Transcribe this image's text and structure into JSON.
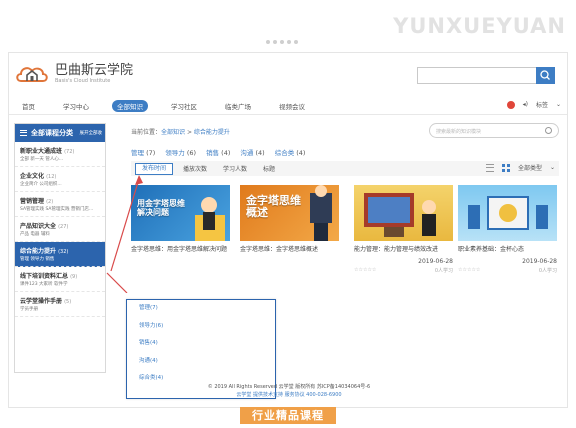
{
  "watermark": "YUNXUEYUAN",
  "logo": {
    "cn": "巴曲斯云学院",
    "en": "Basis's Cloud Institute"
  },
  "nav": {
    "items": [
      "首页",
      "学习中心",
      "全部知识",
      "学习社区",
      "临类广场",
      "视频会议"
    ],
    "right_label": "标签"
  },
  "sidebar": {
    "title": "全部课程分类",
    "toggle": "展开全部收",
    "categories": [
      {
        "title": "新职业大通成班",
        "count": "(72)",
        "subs": "全部  新一天  管人心..."
      },
      {
        "title": "企业文化",
        "count": "(12)",
        "subs": "企业简介  公司组织..."
      },
      {
        "title": "营销管理",
        "count": "(2)",
        "subs": "SA管理实践  SA管理实践  营销门店..."
      },
      {
        "title": "产品知识大全",
        "count": "(27)",
        "subs": "产品  电器  辅料"
      },
      {
        "title": "综合能力提升",
        "count": "(32)",
        "subs": "管理  领导力  销售"
      },
      {
        "title": "线下培训资料汇总",
        "count": "(9)",
        "subs": "课件123  大家听  软件学"
      },
      {
        "title": "云学堂操作手册",
        "count": "(5)",
        "subs": "学员手册"
      }
    ]
  },
  "breadcrumb": {
    "prefix": "当前位置：",
    "link1": "全部知识",
    "sep": " > ",
    "current": "综合能力提升"
  },
  "search_placeholder": "搜索最新的知识模块",
  "filters": [
    {
      "name": "管理",
      "count": "(7)"
    },
    {
      "name": "领导力",
      "count": "(6)"
    },
    {
      "name": "销售",
      "count": "(4)"
    },
    {
      "name": "沟通",
      "count": "(4)"
    },
    {
      "name": "综合类",
      "count": "(4)"
    }
  ],
  "sorts": [
    "发布时间",
    "播放次数",
    "学习人数",
    "标题"
  ],
  "course_type": "全部类型",
  "cards": [
    {
      "title": "金字塔思维：用金字塔思维解决问题",
      "thumb": "用金字塔思维\n解决问题",
      "date": "",
      "learners": ""
    },
    {
      "title": "金字塔思维：金字塔思维概述",
      "thumb": "金字塔思维\n概述",
      "date": "",
      "learners": ""
    },
    {
      "title": "能力管理：能力管理与绩效改进",
      "thumb": "",
      "date": "2019-06-28",
      "learners": "0人学习"
    },
    {
      "title": "职业素养基础：金杯心态",
      "thumb": "",
      "date": "2019-06-28",
      "learners": "0人学习"
    }
  ],
  "popup_items": [
    "管理(7)",
    "领导力(6)",
    "销售(4)",
    "沟通(4)",
    "综合类(4)"
  ],
  "footer": {
    "copyright": "© 2019 All Rights Reserved  云学堂 版权所有  苏ICP备14034064号-6",
    "links": "云学堂 提供技术支持  服务协议  400-028-6900"
  },
  "caption": "行业精品课程",
  "colors": {
    "accent": "#2c64ad",
    "link": "#3d7dc4",
    "caption": "#f0a048",
    "arrow": "#d94a4a"
  }
}
